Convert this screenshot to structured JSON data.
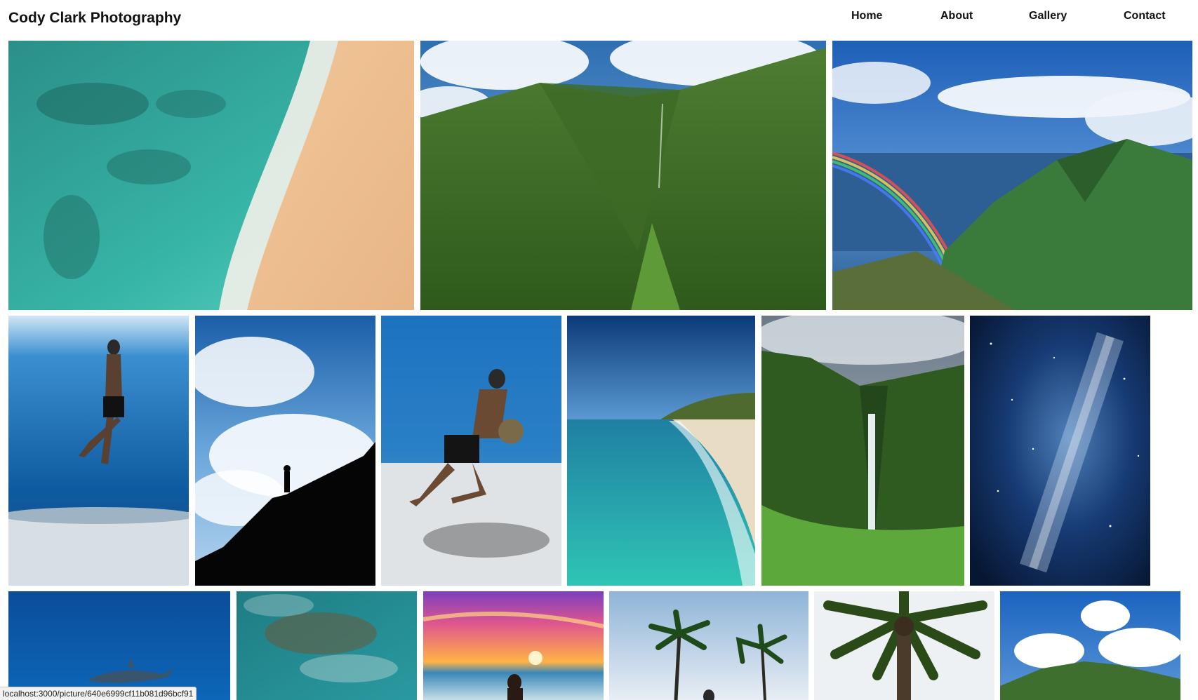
{
  "header": {
    "site_title": "Cody Clark Photography",
    "nav": [
      "Home",
      "About",
      "Gallery",
      "Contact"
    ]
  },
  "gallery": {
    "photos": [
      {
        "subject": "aerial beach with turquoise reef",
        "orientation": "landscape"
      },
      {
        "subject": "green mountain valley with waterfalls",
        "orientation": "landscape"
      },
      {
        "subject": "coastal cliffs with double rainbow",
        "orientation": "landscape"
      },
      {
        "subject": "freediver swimming underwater",
        "orientation": "portrait"
      },
      {
        "subject": "silhouette of person on cliff against sky",
        "orientation": "portrait"
      },
      {
        "subject": "freediver carrying rock over sand",
        "orientation": "portrait"
      },
      {
        "subject": "turquoise beach and headland",
        "orientation": "portrait"
      },
      {
        "subject": "jungle waterfall",
        "orientation": "portrait"
      },
      {
        "subject": "milky way night sky",
        "orientation": "portrait"
      },
      {
        "subject": "dolphin in deep blue water",
        "orientation": "landscape"
      },
      {
        "subject": "underwater wave surface",
        "orientation": "portrait"
      },
      {
        "subject": "woman on beach at sunset",
        "orientation": "portrait"
      },
      {
        "subject": "palm trees by the beach",
        "orientation": "landscape"
      },
      {
        "subject": "palm tree from below",
        "orientation": "portrait"
      },
      {
        "subject": "clouds over green mountain",
        "orientation": "portrait"
      }
    ]
  },
  "status_bar": {
    "url": "localhost:3000/picture/640e6999cf11b081d96bcf91"
  }
}
